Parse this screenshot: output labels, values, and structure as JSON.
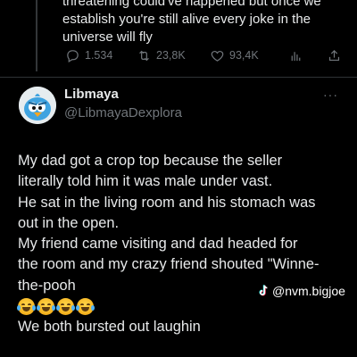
{
  "previous_tweet": {
    "text_lines": [
      "threatening could've happened but once we",
      "establish you're still alive every joke in the",
      "universe will fly"
    ],
    "stats": {
      "replies": "1.534",
      "retweets": "23,8K",
      "likes": "93,4K"
    }
  },
  "tweet": {
    "author_name": "Libmaya",
    "author_handle": "@LibmayaDexplora",
    "more_label": "···",
    "lines": [
      "My dad got a crop top because the seller",
      "literally told him it was male under vast.",
      "He sat in the living room and his stomach was",
      "out in the open.",
      "My friend came visiting and dad headed for",
      "the room and my crazy friend shouted \"Winne-",
      "the-pooh"
    ],
    "emojis": [
      "face-with-tears-of-joy",
      "face-with-tears-of-joy",
      "loudly-crying-face",
      "loudly-crying-face"
    ],
    "last_line": "We both bursted out laughin"
  },
  "watermark": {
    "text": "@nvm.bigjoe",
    "icon": "tiktok-icon"
  },
  "colors": {
    "background": "#000000",
    "text": "#e7e9ea",
    "muted": "#71767b",
    "divider": "#2f3336"
  }
}
